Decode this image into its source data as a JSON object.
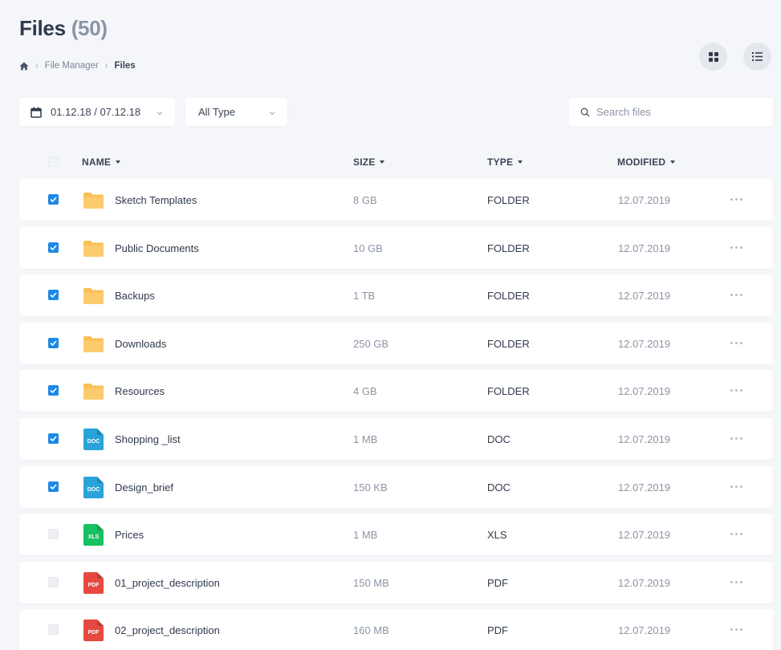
{
  "header": {
    "title": "Files",
    "count": "(50)"
  },
  "breadcrumb": {
    "home_icon": "home-icon",
    "items": [
      "File Manager",
      "Files"
    ]
  },
  "view": {
    "grid_icon": "grid-view-icon",
    "list_icon": "list-view-icon"
  },
  "filters": {
    "date_range": "01.12.18 / 07.12.18",
    "type": "All Type"
  },
  "search": {
    "placeholder": "Search files"
  },
  "table": {
    "columns": {
      "name": "NAME",
      "size": "SIZE",
      "type": "TYPE",
      "modified": "MODIFIED"
    },
    "rows": [
      {
        "name": "Sketch Templates",
        "size": "8 GB",
        "type": "FOLDER",
        "modified": "12.07.2019",
        "checked": true,
        "icon": "folder"
      },
      {
        "name": "Public Documents",
        "size": "10 GB",
        "type": "FOLDER",
        "modified": "12.07.2019",
        "checked": true,
        "icon": "folder"
      },
      {
        "name": "Backups",
        "size": "1 TB",
        "type": "FOLDER",
        "modified": "12.07.2019",
        "checked": true,
        "icon": "folder"
      },
      {
        "name": "Downloads",
        "size": "250 GB",
        "type": "FOLDER",
        "modified": "12.07.2019",
        "checked": true,
        "icon": "folder"
      },
      {
        "name": "Resources",
        "size": "4 GB",
        "type": "FOLDER",
        "modified": "12.07.2019",
        "checked": true,
        "icon": "folder"
      },
      {
        "name": "Shopping _list",
        "size": "1 MB",
        "type": "DOC",
        "modified": "12.07.2019",
        "checked": true,
        "icon": "doc",
        "badge": "DOC"
      },
      {
        "name": "Design_brief",
        "size": "150 KB",
        "type": "DOC",
        "modified": "12.07.2019",
        "checked": true,
        "icon": "doc",
        "badge": "DOC"
      },
      {
        "name": "Prices",
        "size": "1 MB",
        "type": "XLS",
        "modified": "12.07.2019",
        "checked": false,
        "icon": "xls",
        "badge": "XLS"
      },
      {
        "name": "01_project_description",
        "size": "150 MB",
        "type": "PDF",
        "modified": "12.07.2019",
        "checked": false,
        "icon": "pdf",
        "badge": "PDF"
      },
      {
        "name": "02_project_description",
        "size": "160 MB",
        "type": "PDF",
        "modified": "12.07.2019",
        "checked": false,
        "icon": "pdf",
        "badge": "PDF"
      }
    ]
  },
  "colors": {
    "accent": "#1e88e5",
    "folder": "#fbbf55",
    "doc": "#29a3d9",
    "xls": "#17c15f",
    "pdf": "#e6493f"
  }
}
